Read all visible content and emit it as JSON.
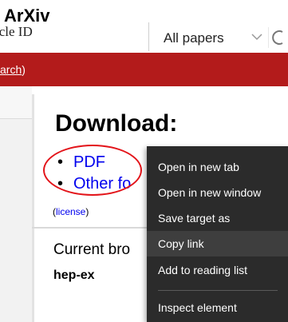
{
  "caption": "ArXiv",
  "topbar": {
    "cut_text": "icle ID",
    "search_scope": "All papers"
  },
  "redbar": {
    "link_text": "arch",
    "close_paren": ")"
  },
  "download": {
    "title": "Download:",
    "pdf_label": "PDF",
    "other_label": "Other fo",
    "license_open": "(",
    "license_label": "license",
    "license_close": ")"
  },
  "browse": {
    "current_label": "Current bro",
    "category": "hep-ex"
  },
  "context_menu": {
    "items": [
      "Open in new tab",
      "Open in new window",
      "Save target as",
      "Copy link",
      "Add to reading list",
      "Inspect element"
    ],
    "highlighted": "Copy link"
  },
  "colors": {
    "arxiv_red": "#b31b1b",
    "link_blue": "#0000ee",
    "menu_bg": "#2b2b2b",
    "annotation_red": "#e3141a"
  }
}
